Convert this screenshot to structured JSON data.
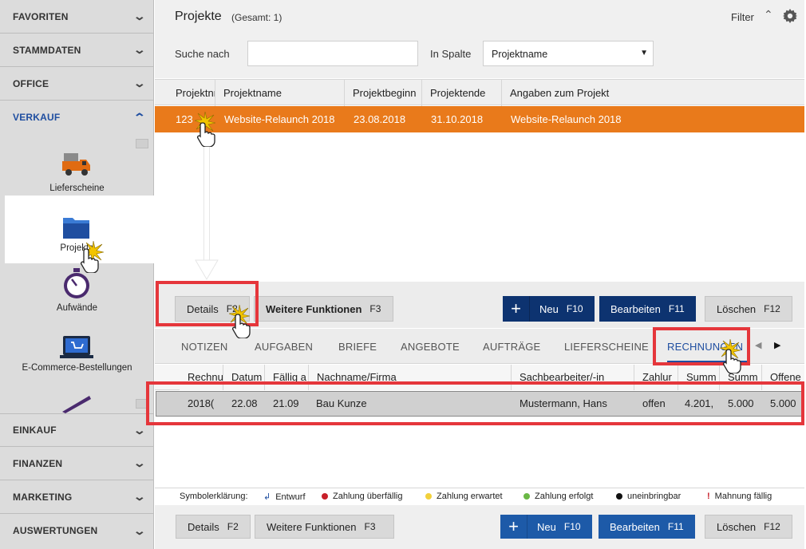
{
  "sidebar": {
    "nav_top": [
      {
        "label": "FAVORITEN"
      },
      {
        "label": "STAMMDATEN"
      },
      {
        "label": "OFFICE"
      },
      {
        "label": "VERKAUF"
      }
    ],
    "modules": [
      {
        "label": "Lieferscheine",
        "icon": "truck-icon"
      },
      {
        "label": "Projekte",
        "icon": "folder-icon"
      },
      {
        "label": "Aufwände",
        "icon": "stopwatch-icon"
      },
      {
        "label": "E-Commerce-Bestellungen",
        "icon": "laptop-cart-icon"
      }
    ],
    "nav_bottom": [
      {
        "label": "EINKAUF"
      },
      {
        "label": "FINANZEN"
      },
      {
        "label": "MARKETING"
      },
      {
        "label": "AUSWERTUNGEN"
      }
    ]
  },
  "header": {
    "title": "Projekte",
    "subtitle": "(Gesamt: 1)",
    "filter_label": "Filter"
  },
  "search": {
    "label": "Suche nach",
    "value": "",
    "column_label": "In Spalte",
    "column_value": "Projektname"
  },
  "projects": {
    "columns": [
      "Projektnr",
      "Projektname",
      "Projektbeginn",
      "Projektende",
      "Angaben zum Projekt"
    ],
    "rows": [
      {
        "nr": "123",
        "name": "Website-Relaunch 2018",
        "start": "23.08.2018",
        "end": "31.10.2018",
        "info": "Website-Relaunch 2018"
      }
    ]
  },
  "toolbar": {
    "details": "Details",
    "details_key": "F2",
    "more": "Weitere Funktionen",
    "more_key": "F3",
    "new": "Neu",
    "new_key": "F10",
    "edit": "Bearbeiten",
    "edit_key": "F11",
    "delete": "Löschen",
    "delete_key": "F12"
  },
  "tabs": [
    "NOTIZEN",
    "AUFGABEN",
    "BRIEFE",
    "ANGEBOTE",
    "AUFTRÄGE",
    "LIEFERSCHEINE",
    "RECHNUNGEN"
  ],
  "invoices": {
    "columns": [
      "Rechnu",
      "Datum",
      "Fällig a",
      "Nachname/Firma",
      "Sachbearbeiter/-in",
      "Zahlur",
      "Summ",
      "Summ",
      "Offene"
    ],
    "rows": [
      {
        "nr": "2018(",
        "date": "22.08",
        "due": "21.09",
        "name": "Bau Kunze",
        "agent": "Mustermann, Hans",
        "status": "offen",
        "sum1": "4.201,",
        "sum2": "5.000",
        "open": "5.000"
      }
    ]
  },
  "legend": {
    "title": "Symbolerklärung:",
    "items": [
      {
        "label": "Entwurf",
        "color": "#1f4ea0"
      },
      {
        "label": "Zahlung überfällig",
        "color": "#c8202a"
      },
      {
        "label": "Zahlung erwartet",
        "color": "#f2d13b"
      },
      {
        "label": "Zahlung erfolgt",
        "color": "#6ab845"
      },
      {
        "label": "uneinbringbar",
        "color": "#111111"
      },
      {
        "label": "Mahnung fällig",
        "color": "#c8202a"
      }
    ]
  },
  "colors": {
    "accent": "#1f4ea0",
    "selection": "#e97a1b",
    "highlight": "#e5363b"
  }
}
